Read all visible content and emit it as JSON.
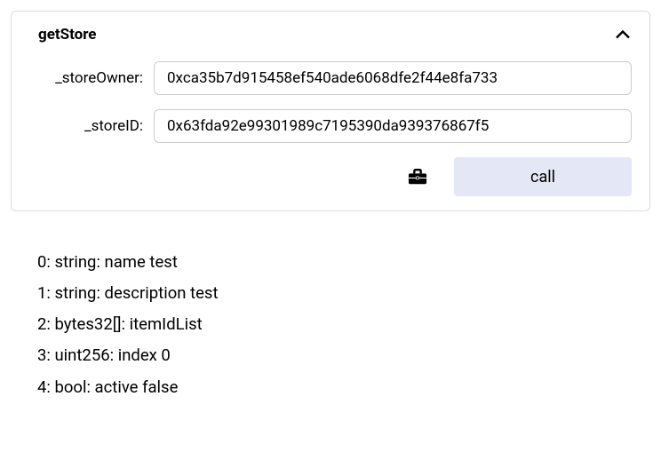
{
  "panel": {
    "title": "getStore",
    "fields": {
      "storeOwner": {
        "label": "_storeOwner:",
        "value": "0xca35b7d915458ef540ade6068dfe2f44e8fa733"
      },
      "storeID": {
        "label": "_storeID:",
        "value": "0x63fda92e99301989c7195390da939376867f5"
      }
    },
    "callButton": "call"
  },
  "results": [
    "0: string: name test",
    "1: string: description test",
    "2: bytes32[]: itemIdList",
    "3: uint256: index 0",
    "4: bool: active false"
  ]
}
